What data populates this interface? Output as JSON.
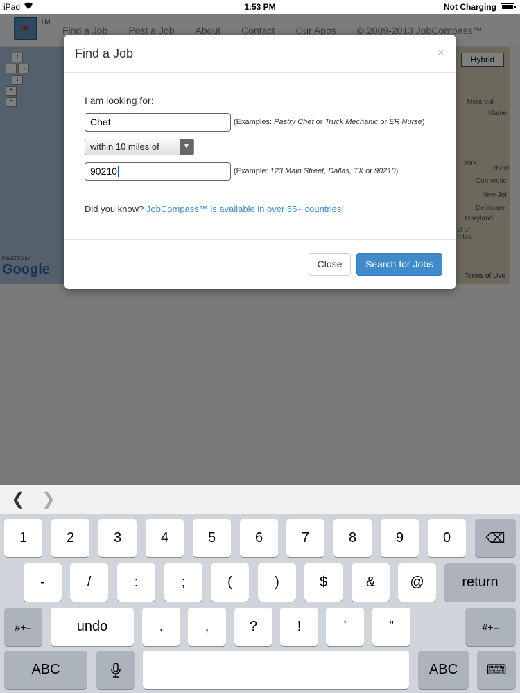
{
  "status_bar": {
    "device": "iPad",
    "time": "1:53 PM",
    "battery": "Not Charging"
  },
  "navbar": {
    "links": [
      "Find a Job",
      "Post a Job",
      "About",
      "Contact",
      "Our Apps"
    ],
    "copyright": "© 2009-2013 JobCompass™",
    "logo_tm": "TM"
  },
  "map": {
    "hybrid_label": "Hybrid",
    "powered_by": "POWERED BY",
    "google": "Google",
    "terms": "Terms of Use",
    "place_labels": [
      "Montreal",
      "Maine",
      "York",
      "Rhode",
      "Connectic",
      "New Jer",
      "Delaware",
      "Maryland",
      "ct of",
      "mbia"
    ]
  },
  "modal": {
    "title": "Find a Job",
    "close_x": "×",
    "looking_label": "I am looking for:",
    "job_value": "Chef",
    "job_hint_prefix": "(Examples: ",
    "job_hint_ex1": "Pastry Chef",
    "job_hint_or1": " or ",
    "job_hint_ex2": "Truck Mechanic",
    "job_hint_or2": " or ",
    "job_hint_ex3": "ER Nurse",
    "job_hint_suffix": ")",
    "radius_value": "within 10 miles of",
    "location_value": "90210",
    "loc_hint_prefix": "(Example: ",
    "loc_hint_ex1": "123 Main Street, Dallas, TX",
    "loc_hint_or": " or ",
    "loc_hint_ex2": "90210",
    "loc_hint_suffix": ")",
    "did_you_know": "Did you know?",
    "did_you_know_link": "JobCompass™ is available in over 55+ countries!",
    "close_button": "Close",
    "search_button": "Search for Jobs"
  },
  "keyboard": {
    "row1": [
      "1",
      "2",
      "3",
      "4",
      "5",
      "6",
      "7",
      "8",
      "9",
      "0"
    ],
    "delete_icon": "⌫",
    "row2": [
      "-",
      "/",
      ":",
      ";",
      "(",
      ")",
      "$",
      "&",
      "@"
    ],
    "return": "return",
    "row3_left": "#+=",
    "undo": "undo",
    "row3": [
      ".",
      ",",
      "?",
      "!",
      "’",
      "”"
    ],
    "row3_right": "#+=",
    "abc_left": "ABC",
    "mic_icon": "🎙",
    "abc_right": "ABC",
    "hide_keyboard_icon": "⌨"
  }
}
